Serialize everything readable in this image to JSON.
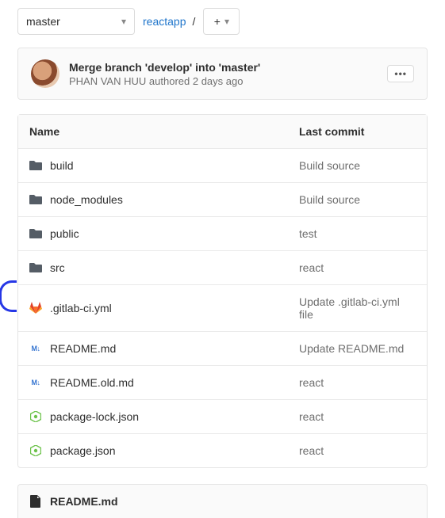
{
  "branch": {
    "name": "master"
  },
  "breadcrumb": {
    "root": "reactapp",
    "separator": "/"
  },
  "latest_commit": {
    "message": "Merge branch 'develop' into 'master'",
    "author": "PHAN VAN HUU",
    "verb": "authored",
    "time": "2 days ago"
  },
  "table": {
    "headers": {
      "name": "Name",
      "commit": "Last commit"
    },
    "rows": [
      {
        "icon": "folder",
        "name": "build",
        "commit": "Build source"
      },
      {
        "icon": "folder",
        "name": "node_modules",
        "commit": "Build source"
      },
      {
        "icon": "folder",
        "name": "public",
        "commit": "test"
      },
      {
        "icon": "folder",
        "name": "src",
        "commit": "react"
      },
      {
        "icon": "gitlab",
        "name": ".gitlab-ci.yml",
        "commit": "Update .gitlab-ci.yml file",
        "marker": true
      },
      {
        "icon": "md",
        "name": "README.md",
        "commit": "Update README.md"
      },
      {
        "icon": "md",
        "name": "README.old.md",
        "commit": "react"
      },
      {
        "icon": "npm",
        "name": "package-lock.json",
        "commit": "react"
      },
      {
        "icon": "npm",
        "name": "package.json",
        "commit": "react"
      }
    ]
  },
  "readme": {
    "filename": "README.md"
  }
}
